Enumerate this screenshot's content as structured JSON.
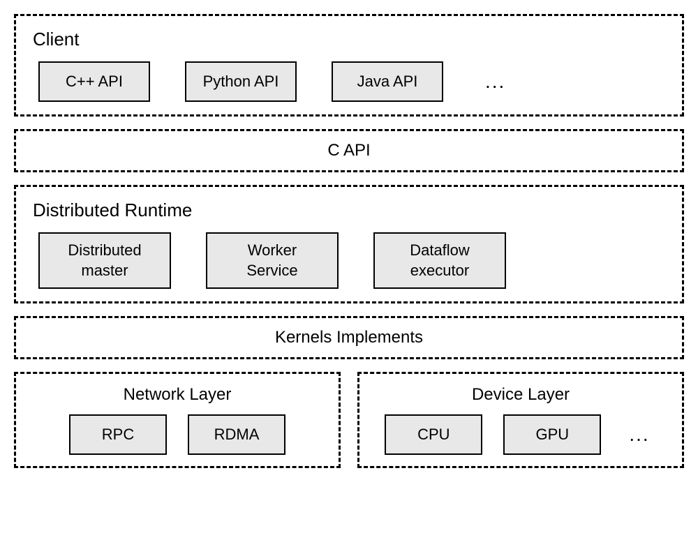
{
  "client": {
    "title": "Client",
    "items": [
      {
        "label": "C++ API"
      },
      {
        "label": "Python API"
      },
      {
        "label": "Java API"
      }
    ],
    "ellipsis": "..."
  },
  "c_api": {
    "label": "C API"
  },
  "distributed_runtime": {
    "title": "Distributed Runtime",
    "items": [
      {
        "line1": "Distributed",
        "line2": "master"
      },
      {
        "line1": "Worker",
        "line2": "Service"
      },
      {
        "line1": "Dataflow",
        "line2": "executor"
      }
    ]
  },
  "kernels": {
    "label": "Kernels Implements"
  },
  "network_layer": {
    "title": "Network Layer",
    "items": [
      {
        "label": "RPC"
      },
      {
        "label": "RDMA"
      }
    ]
  },
  "device_layer": {
    "title": "Device Layer",
    "items": [
      {
        "label": "CPU"
      },
      {
        "label": "GPU"
      }
    ],
    "ellipsis": "..."
  }
}
